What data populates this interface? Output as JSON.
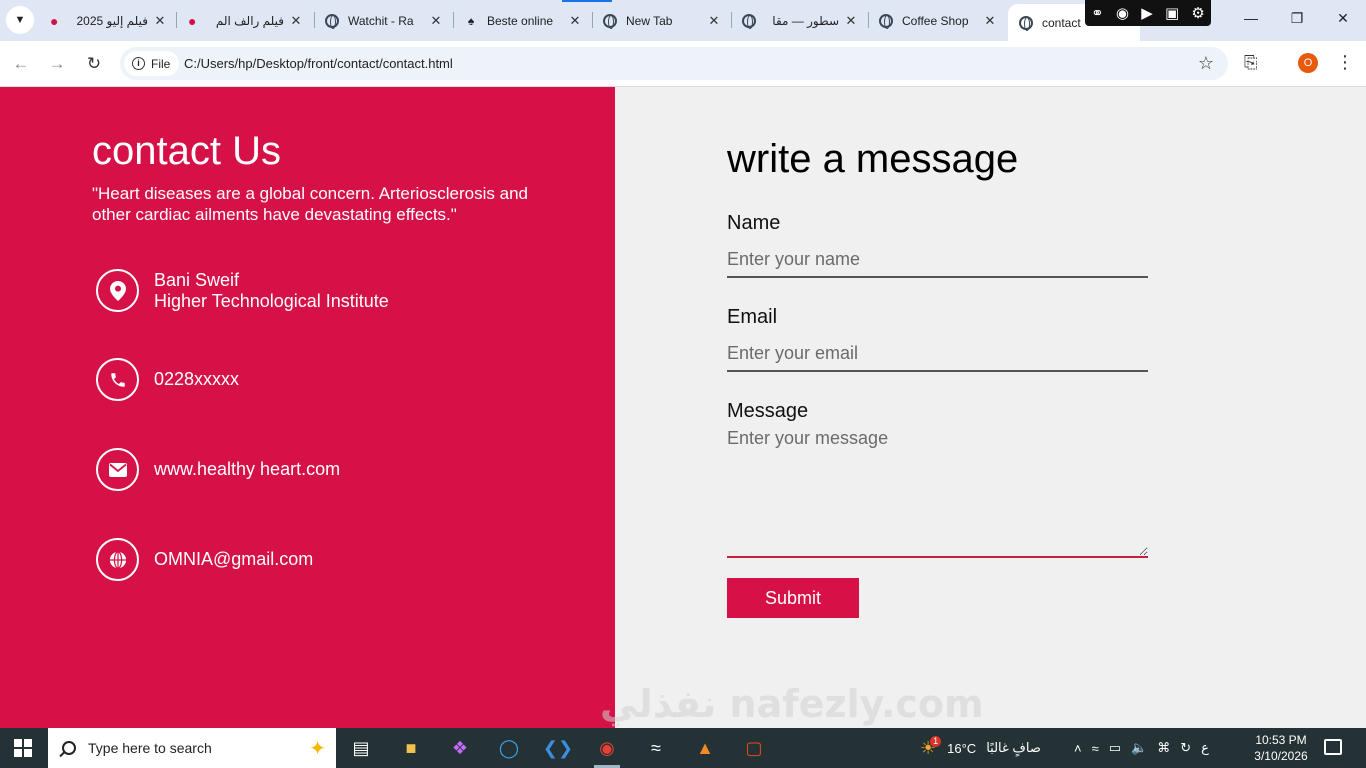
{
  "browser": {
    "tabs": [
      {
        "label": "فيلم إليو 2025",
        "icon": "red-logo-icon"
      },
      {
        "label": "فيلم رالف الم",
        "icon": "red-logo-icon"
      },
      {
        "label": "Watchit - Ra",
        "icon": "globe-icon"
      },
      {
        "label": "Beste online",
        "icon": "game-icon"
      },
      {
        "label": "New Tab",
        "icon": "globe-icon"
      },
      {
        "label": "سطور — مقا",
        "icon": "globe-icon"
      },
      {
        "label": "Coffee Shop",
        "icon": "globe-icon"
      },
      {
        "label": "contact",
        "icon": "globe-icon",
        "active": true
      }
    ],
    "file_chip": "File",
    "url": "C:/Users/hp/Desktop/front/contact/contact.html",
    "profile_initial": "O"
  },
  "contact": {
    "title": "contact Us",
    "quote": "\"Heart diseases are a global concern. Arteriosclerosis and other cardiac ailments have devastating effects.\"",
    "address_line1": "Bani Sweif",
    "address_line2": "Higher Technological Institute",
    "phone": "0228xxxxx",
    "website": "www.healthy heart.com",
    "email": "OMNIA@gmail.com"
  },
  "form": {
    "title": "write a message",
    "name_label": "Name",
    "name_placeholder": "Enter your name",
    "email_label": "Email",
    "email_placeholder": "Enter your email",
    "message_label": "Message",
    "message_placeholder": "Enter your message",
    "submit_label": "Submit"
  },
  "taskbar": {
    "search_placeholder": "Type here to search",
    "weather_temp": "16°C",
    "weather_text": "صافٍ غالبًا",
    "weather_badge": "1",
    "lang": "ع",
    "time": "10:53 PM",
    "date": "3/10/2026"
  },
  "watermark": "نفذلي nafezly.com",
  "colors": {
    "accent": "#d51147",
    "panel": "#f0f0f0",
    "taskbar": "#243135"
  }
}
